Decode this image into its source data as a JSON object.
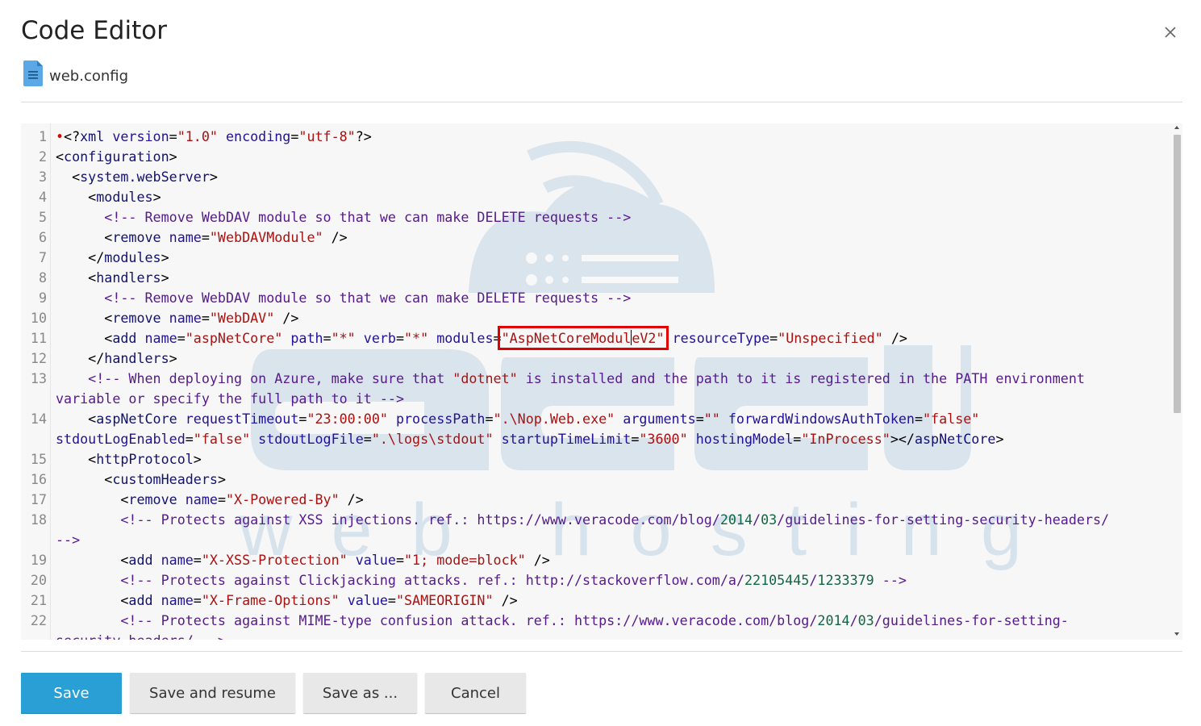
{
  "dialog": {
    "title": "Code Editor",
    "file_name": "web.config"
  },
  "watermark": {
    "text_big": "accu",
    "text_small": "web hosting"
  },
  "editor": {
    "line_numbers": [
      "1",
      "2",
      "3",
      "4",
      "5",
      "6",
      "7",
      "8",
      "9",
      "10",
      "11",
      "12",
      "13",
      "14",
      "15",
      "16",
      "17",
      "18",
      "19",
      "20",
      "21",
      "22"
    ],
    "highlighted_value": "AspNetCoreModuleV2"
  },
  "buttons": {
    "save": "Save",
    "save_and_resume": "Save and resume",
    "save_as": "Save as ...",
    "cancel": "Cancel"
  },
  "colors": {
    "primary": "#2a9fd6",
    "highlight_box": "#e00000"
  }
}
